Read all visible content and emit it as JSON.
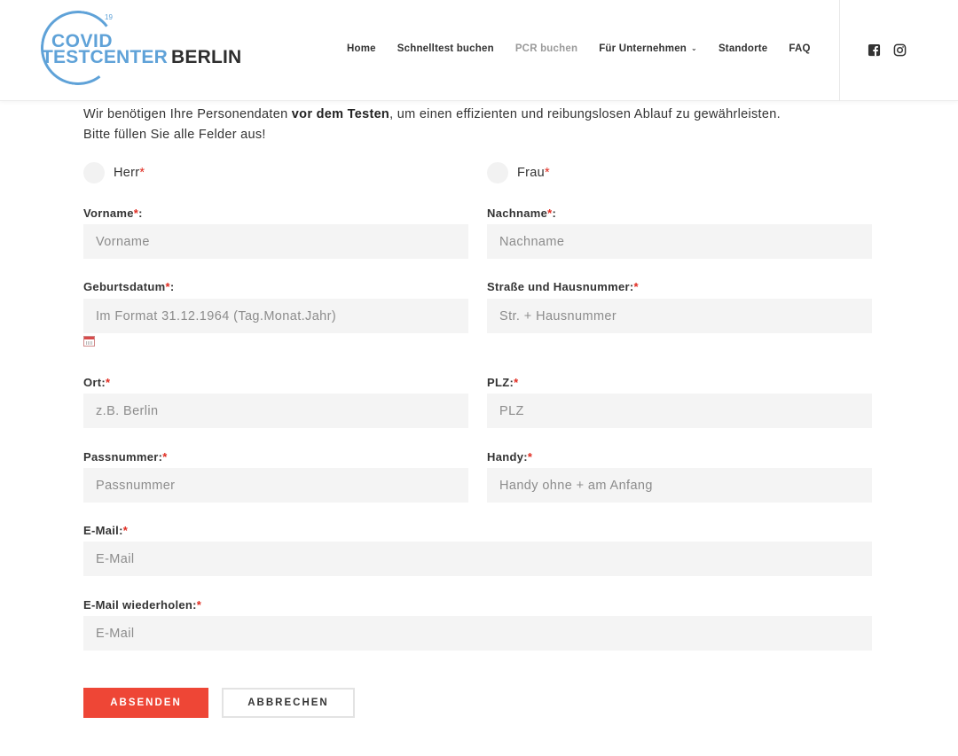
{
  "logo": {
    "sup": "19",
    "line1": "COVID",
    "line2a": "TESTCENTER",
    "line2b": "BERLIN"
  },
  "nav": {
    "items": [
      {
        "label": "Home"
      },
      {
        "label": "Schnelltest buchen"
      },
      {
        "label": "PCR buchen"
      },
      {
        "label": "Für Unternehmen"
      },
      {
        "label": "Standorte"
      },
      {
        "label": "FAQ"
      }
    ],
    "dropdown_glyph": "⌄"
  },
  "social": [
    "facebook-icon",
    "instagram-icon"
  ],
  "intro": {
    "part1": "Wir benötigen Ihre Personendaten ",
    "bold": "vor dem Testen",
    "part2": ", um einen effizienten und reibungslosen Ablauf zu gewährleisten.",
    "line2": "Bitte füllen Sie alle Felder aus!"
  },
  "required_mark": "*",
  "salutation": {
    "mr": "Herr",
    "mrs": "Frau"
  },
  "fields": {
    "vorname": {
      "label": "Vorname",
      "suffix": ":",
      "placeholder": "Vorname",
      "value": ""
    },
    "nachname": {
      "label": "Nachname",
      "suffix": ":",
      "placeholder": "Nachname",
      "value": ""
    },
    "geburtsdatum": {
      "label": "Geburtsdatum",
      "suffix": ":",
      "placeholder": "Im Format 31.12.1964 (Tag.Monat.Jahr)",
      "value": ""
    },
    "strasse": {
      "label": "Straße und Hausnummer:",
      "suffix": "",
      "placeholder": "Str. + Hausnummer",
      "value": ""
    },
    "ort": {
      "label": "Ort:",
      "suffix": "",
      "placeholder": "z.B. Berlin",
      "value": ""
    },
    "plz": {
      "label": "PLZ:",
      "suffix": "",
      "placeholder": "PLZ",
      "value": ""
    },
    "passnummer": {
      "label": "Passnummer:",
      "suffix": "",
      "placeholder": "Passnummer",
      "value": ""
    },
    "handy": {
      "label": "Handy:",
      "suffix": "",
      "placeholder": "Handy ohne + am Anfang",
      "value": ""
    },
    "email": {
      "label": "E-Mail:",
      "suffix": "",
      "placeholder": "E-Mail",
      "value": ""
    },
    "email_repeat": {
      "label": "E-Mail wiederholen:",
      "suffix": "",
      "placeholder": "E-Mail",
      "value": ""
    }
  },
  "buttons": {
    "submit": "ABSENDEN",
    "cancel": "ABBRECHEN"
  },
  "colors": {
    "brand_blue": "#5fa2d8",
    "accent_red": "#ee4636",
    "required_red": "#e02b20",
    "input_bg": "#f4f4f4"
  }
}
